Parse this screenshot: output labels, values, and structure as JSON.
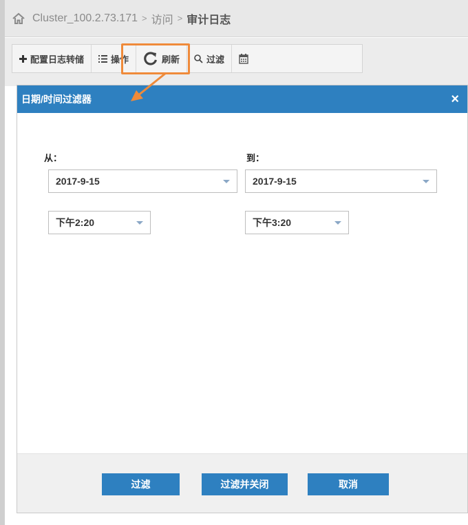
{
  "breadcrumb": {
    "cluster": "Cluster_100.2.73.171",
    "separator": ">",
    "section": "访问",
    "current": "审计日志"
  },
  "toolbar": {
    "config_forwarding": "配置日志转储",
    "operations": "操作",
    "refresh": "刷新",
    "filter": "过滤"
  },
  "dialog": {
    "title": "日期/时间过滤器",
    "close": "×",
    "from_label": "从：",
    "to_label": "到：",
    "from_date": "2017-9-15",
    "to_date": "2017-9-15",
    "from_time": "下午2:20",
    "to_time": "下午3:20",
    "buttons": {
      "filter": "过滤",
      "filter_close": "过滤并关闭",
      "cancel": "取消"
    }
  },
  "colors": {
    "accent": "#2e80c0",
    "highlight": "#ef8a3a"
  }
}
